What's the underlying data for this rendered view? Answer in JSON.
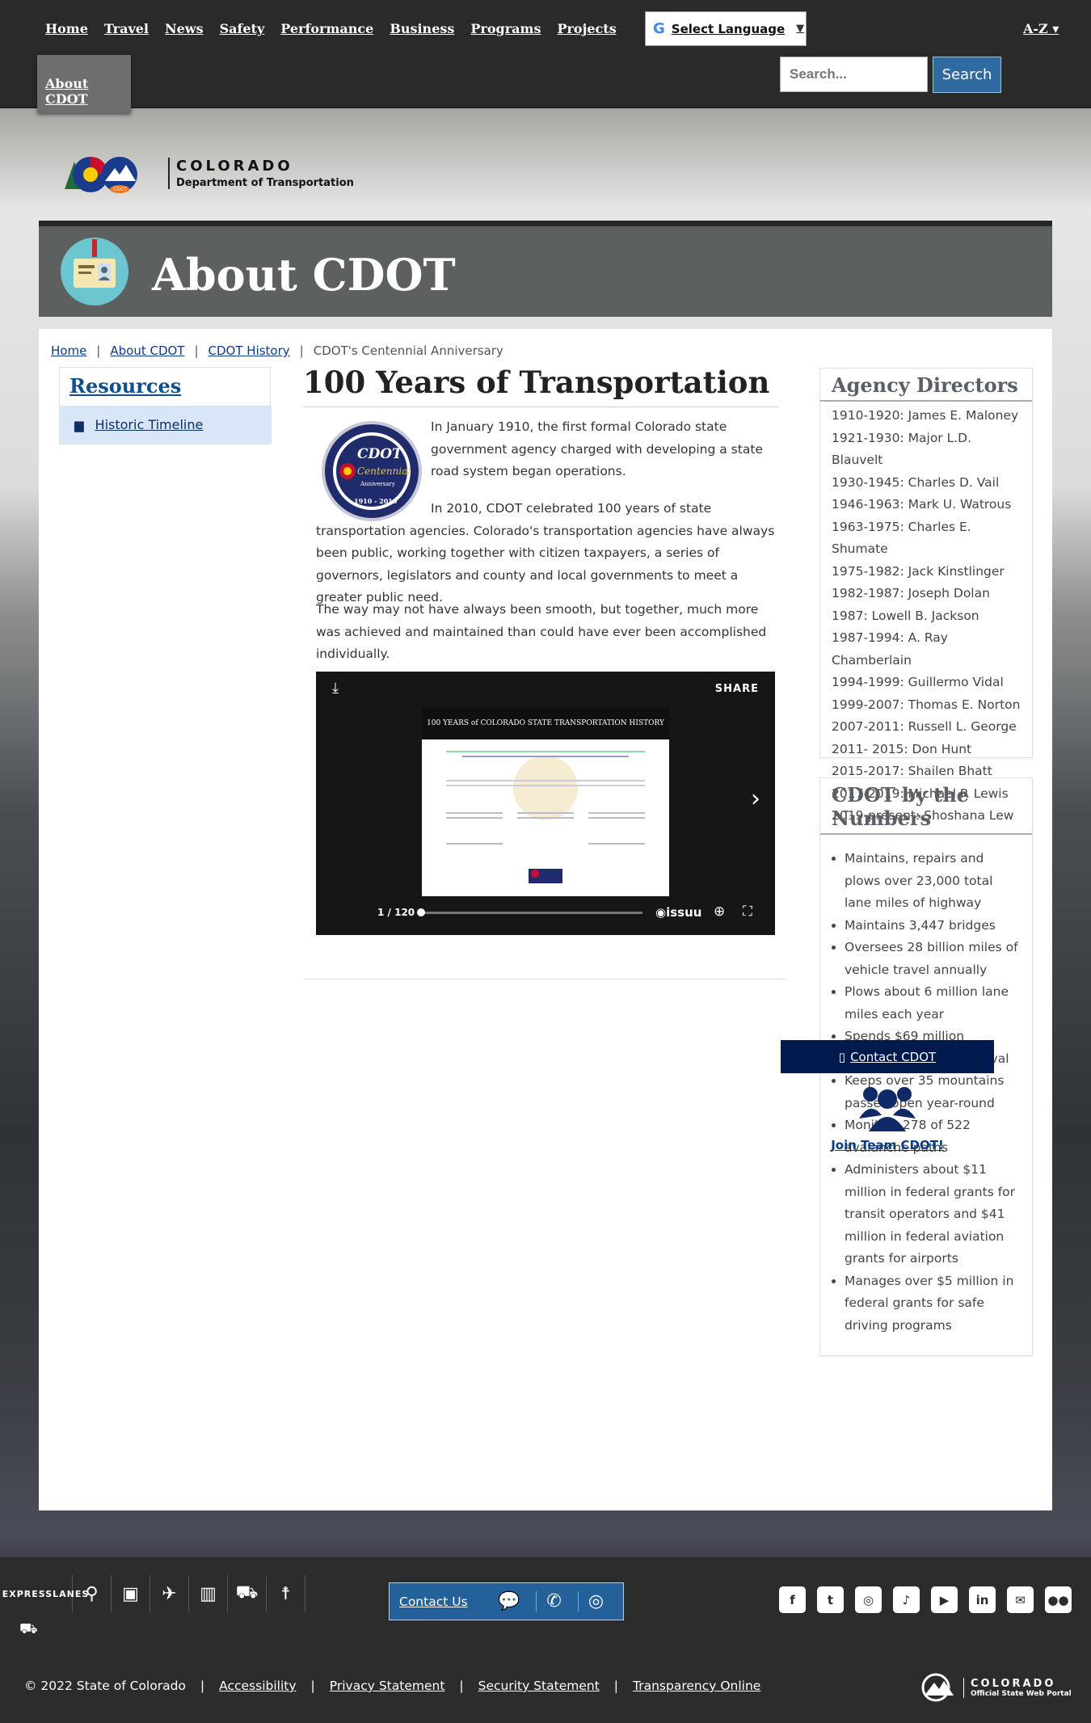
{
  "nav": {
    "items": [
      "Home",
      "Travel",
      "News",
      "Safety",
      "Performance",
      "Business",
      "Programs",
      "Projects"
    ],
    "about": "About CDOT",
    "az": "A-Z"
  },
  "language": {
    "label": "Select Language"
  },
  "search": {
    "placeholder": "Search...",
    "button": "Search"
  },
  "logo": {
    "title": "COLORADO",
    "subtitle": "Department of Transportation",
    "small": "CDOT"
  },
  "banner": {
    "title": "About CDOT"
  },
  "breadcrumb": [
    "Home",
    "About CDOT",
    "CDOT History",
    "CDOT's Centennial Anniversary"
  ],
  "resources": {
    "title": "Resources",
    "item": "Historic Timeline"
  },
  "article": {
    "title": "100 Years of Transportation",
    "seal_text": [
      "CDOT",
      "Centennial",
      "Anniversary",
      "1910 - 2010"
    ],
    "p1": "In January 1910, the first formal Colorado state government agency charged with developing a state road system began operations.",
    "p2": "In 2010, CDOT celebrated 100 years of state transportation agencies. Colorado's transportation agencies have always been public, working together with citizen taxpayers, a series of governors, legislators and county and local governments to meet a greater public need.",
    "p3": "The way may not have always been smooth, but together, much more was achieved and maintained than could have ever been accomplished individually."
  },
  "viewer": {
    "share": "SHARE",
    "page_header": "100 YEARS of COLORADO STATE TRANSPORTATION HISTORY",
    "page_count": "1 / 120",
    "progress": 0.0083,
    "brand": "issuu"
  },
  "directors": {
    "title": "Agency Directors",
    "items": [
      "1910-1920: James E. Maloney",
      "1921-1930: Major L.D. Blauvelt",
      "1930-1945: Charles D. Vail",
      "1946-1963: Mark U. Watrous",
      "1963-1975: Charles E. Shumate",
      "1975-1982: Jack Kinstlinger",
      "1982-1987: Joseph Dolan",
      "1987: Lowell B. Jackson",
      "1987-1994: A. Ray Chamberlain",
      "1994-1999: Guillermo Vidal",
      "1999-2007: Thomas E. Norton",
      "2007-2011: Russell L. George",
      "2011- 2015: Don Hunt",
      "2015-2017: Shailen Bhatt",
      "2017-2019: Michael P. Lewis",
      "2019-present: Shoshana Lew"
    ]
  },
  "numbers": {
    "title": "CDOT by the Numbers",
    "items": [
      "Maintains, repairs and plows over 23,000 total lane miles of highway",
      "Maintains 3,447 bridges",
      "Oversees 28 billion miles of vehicle travel annually",
      "Plows about 6 million lane miles each year",
      "Spends $69 million annually on snow removal",
      "Keeps over 35 mountains passes open year-round",
      "Monitors 278 of 522 avalanche paths",
      "Administers about $11 million in federal grants for transit operators and $41 million in federal aviation grants for airports",
      "Manages over $5 million in federal grants for safe driving programs"
    ]
  },
  "contact": {
    "label": "Contact CDOT"
  },
  "team": {
    "label": "Join Team CDOT!"
  },
  "footer": {
    "express": [
      "EXPRESS",
      "LANES"
    ],
    "contact_us": "Contact Us",
    "copyright": "© 2022 State of Colorado",
    "links": [
      "Accessibility",
      "Privacy Statement",
      "Security Statement",
      "Transparency Online"
    ],
    "state": "COLORADO",
    "portal": "Official State Web Portal"
  }
}
